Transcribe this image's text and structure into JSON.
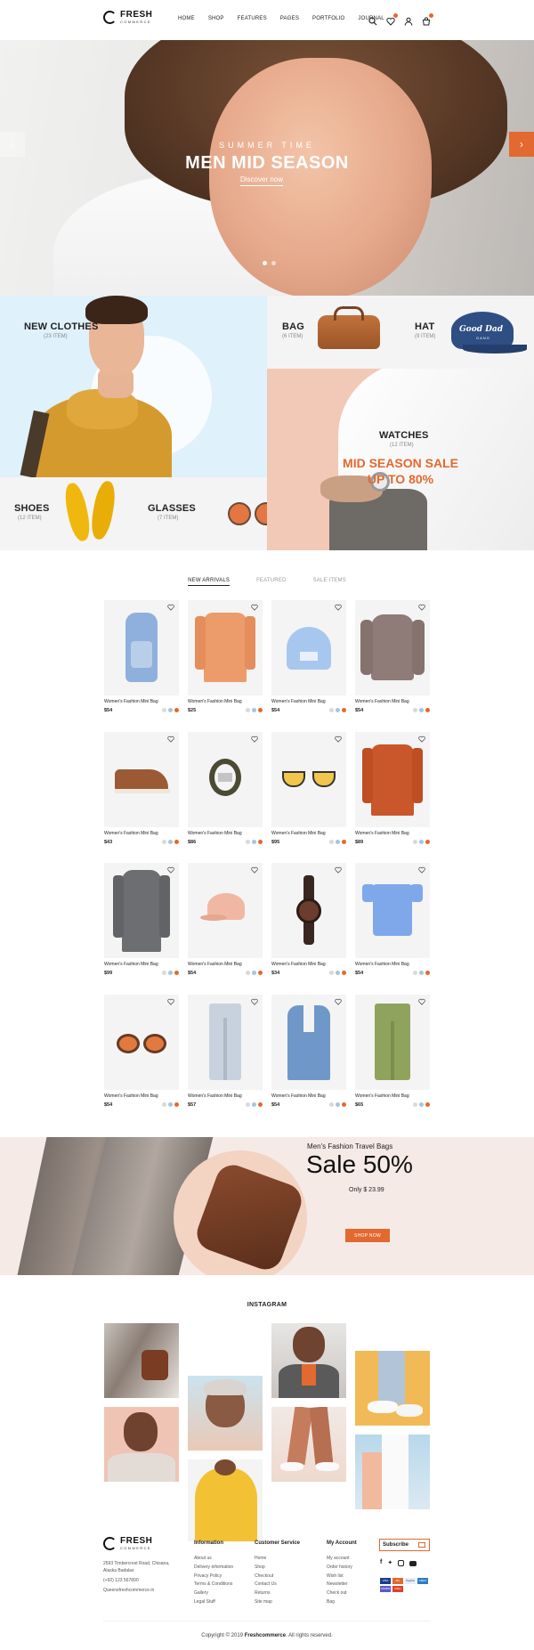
{
  "brand": {
    "name": "FRESH",
    "tagline": "COMMERCE"
  },
  "nav": [
    "HOME",
    "SHOP",
    "FEATURES",
    "PAGES",
    "PORTFOLIO",
    "JOURNAL"
  ],
  "header_icons": [
    "search-icon",
    "heart-icon",
    "user-icon",
    "cart-icon"
  ],
  "hero": {
    "subtitle": "SUMMER TIME",
    "title": "MEN MID SEASON",
    "cta": "Discover now",
    "slide_count": 2,
    "active_slide": 1
  },
  "categories": {
    "new_clothes": {
      "title": "NEW CLOTHES",
      "count": "(23 ITEM)"
    },
    "bag": {
      "title": "BAG",
      "count": "(6 ITEM)"
    },
    "hat": {
      "title": "HAT",
      "count": "(9 ITEM)",
      "hat_text": "Good Dad",
      "hat_subtext": "GANG"
    },
    "shoes": {
      "title": "SHOES",
      "count": "(12 ITEM)"
    },
    "glasses": {
      "title": "GLASSES",
      "count": "(7 ITEM)"
    },
    "watches": {
      "title": "WATCHES",
      "count": "(12 ITEM)",
      "sale_line1": "MID SEASON SALE",
      "sale_line2": "UP TO 80%"
    }
  },
  "tabs": {
    "items": [
      "NEW ARRIVALS",
      "FEATURED",
      "SALE ITEMS"
    ],
    "active": 0
  },
  "products": [
    {
      "name": "Women's Fashion Mini Bag",
      "price": "$54",
      "item": "backpack"
    },
    {
      "name": "Women's Fashion Mini Bag",
      "price": "$25",
      "item": "orange-shirt"
    },
    {
      "name": "Women's Fashion Mini Bag",
      "price": "$54",
      "item": "beanie"
    },
    {
      "name": "Women's Fashion Mini Bag",
      "price": "$54",
      "item": "sweater"
    },
    {
      "name": "Women's Fashion Mini Bag",
      "price": "$43",
      "item": "boot"
    },
    {
      "name": "Women's Fashion Mini Bag",
      "price": "$86",
      "item": "belt"
    },
    {
      "name": "Women's Fashion Mini Bag",
      "price": "$95",
      "item": "sunglasses"
    },
    {
      "name": "Women's Fashion Mini Bag",
      "price": "$89",
      "item": "rust-shirt"
    },
    {
      "name": "Women's Fashion Mini Bag",
      "price": "$99",
      "item": "coat"
    },
    {
      "name": "Women's Fashion Mini Bag",
      "price": "$54",
      "item": "cap"
    },
    {
      "name": "Women's Fashion Mini Bag",
      "price": "$34",
      "item": "watch"
    },
    {
      "name": "Women's Fashion Mini Bag",
      "price": "$54",
      "item": "tshirt"
    },
    {
      "name": "Women's Fashion Mini Bag",
      "price": "$54",
      "item": "round-sunglasses"
    },
    {
      "name": "Women's Fashion Mini Bag",
      "price": "$57",
      "item": "jeans"
    },
    {
      "name": "Women's Fashion Mini Bag",
      "price": "$54",
      "item": "blazer"
    },
    {
      "name": "Women's Fashion Mini Bag",
      "price": "$65",
      "item": "chinos"
    }
  ],
  "swatch_colors": [
    "#d9d9d9",
    "#a9c4dc",
    "#e2692f"
  ],
  "banner": {
    "subtitle": "Men's Fashion Travel Bags",
    "title": "Sale 50%",
    "price": "Only $ 23.99",
    "button": "SHOP NOW"
  },
  "instagram": {
    "title": "INSTAGRAM"
  },
  "footer": {
    "address": [
      "2593 Timbercrest Road, Chisana,",
      "Alaska Badalas",
      "(+92) 123 567890",
      "Queensfreshcommerce.in"
    ],
    "columns": [
      {
        "title": "Information",
        "links": [
          "About us",
          "Delivery information",
          "Privacy Policy",
          "Terms & Conditions",
          "Gallery",
          "Legal Stuff"
        ]
      },
      {
        "title": "Customer Service",
        "links": [
          "Home",
          "Shop",
          "Checkout",
          "Contact Us",
          "Returns",
          "Site map"
        ]
      },
      {
        "title": "My Account",
        "links": [
          "My account",
          "Order history",
          "Wish list",
          "Newsletter",
          "Check out",
          "Bag"
        ]
      }
    ],
    "subscribe": "Subscribe",
    "social": [
      "facebook-icon",
      "twitter-icon",
      "instagram-icon",
      "youtube-icon"
    ],
    "payments": [
      "VISA",
      "MC",
      "PayPal",
      "AMEX",
      "STRIPE",
      "DISC"
    ],
    "copyright_prefix": "Copyright © 2019",
    "copyright_brand": "Freshcommerce",
    "copyright_suffix": ". All rights reserved."
  },
  "colors": {
    "accent": "#e2692f",
    "light_blue": "#dff1fb",
    "peach": "#f1c9b6",
    "light_gray": "#f4f4f4"
  }
}
